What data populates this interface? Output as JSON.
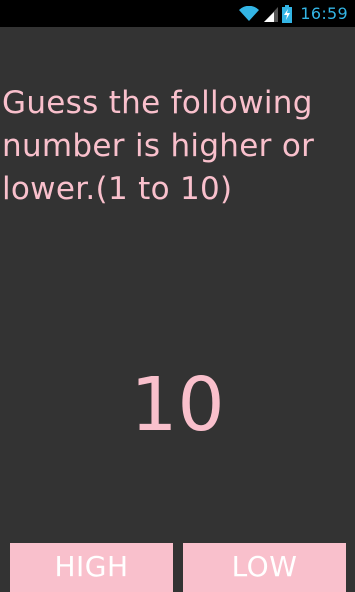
{
  "status_bar": {
    "time": "16:59",
    "icons": [
      "wifi-icon",
      "signal-icon",
      "battery-charging-icon"
    ],
    "accent_color": "#33b5e5"
  },
  "game": {
    "prompt": "Guess the following number is higher or lower.(1 to 10)",
    "current_number": "10",
    "high_label": "HIGH",
    "low_label": "LOW"
  },
  "colors": {
    "background": "#333333",
    "text_pink": "#f9c0cc",
    "button_pink": "#f9c0cc",
    "button_text": "#ffffff"
  }
}
